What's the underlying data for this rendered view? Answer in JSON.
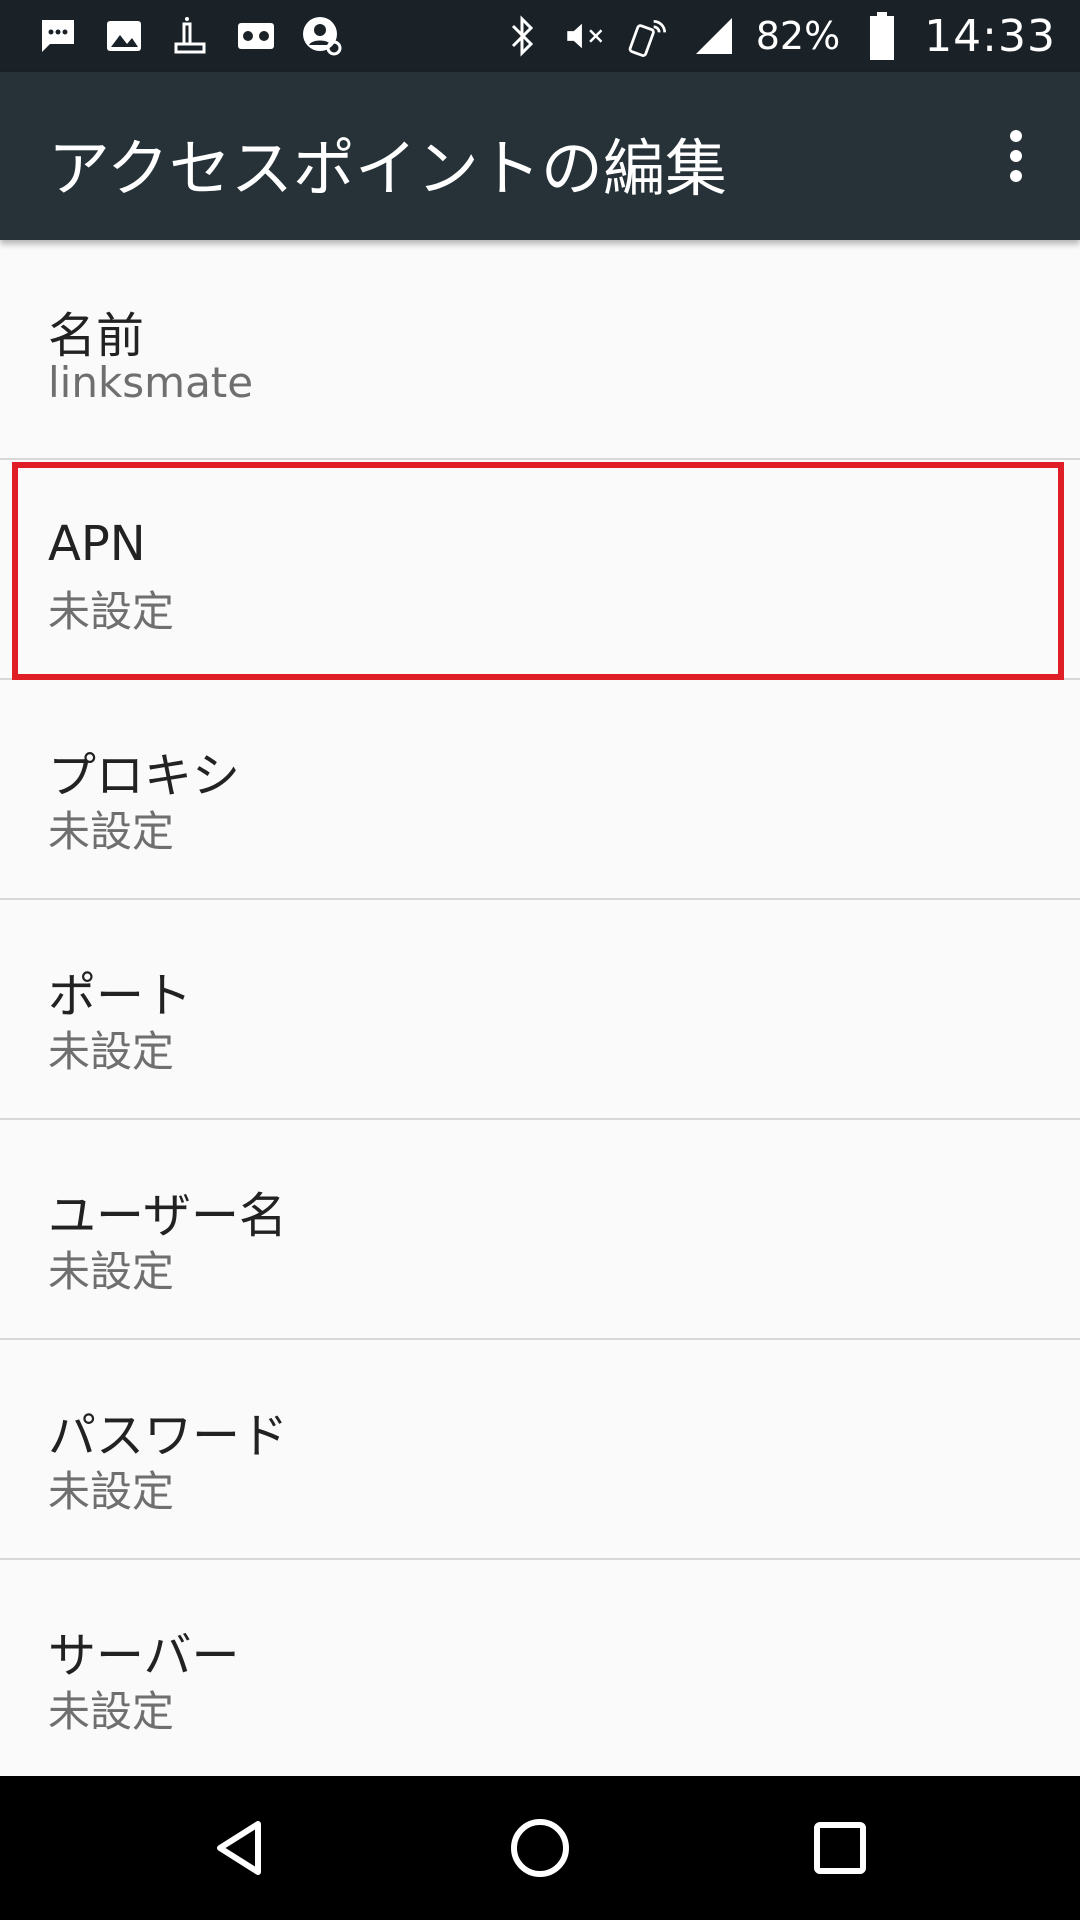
{
  "status_bar": {
    "left_icons": [
      "sms-icon",
      "gallery-icon",
      "app-icon",
      "voicemail-icon",
      "account-icon"
    ],
    "battery_percent_label": "82%",
    "battery_level": 0.82,
    "time": "14:33",
    "right_icons": [
      "bluetooth-icon",
      "mute-icon",
      "nfc-icon",
      "signal-icon",
      "battery-icon"
    ]
  },
  "app_bar": {
    "title": "アクセスポイントの編集",
    "menu_icon": "more-vert-icon"
  },
  "settings": [
    {
      "title": "名前",
      "summary": "linksmate"
    },
    {
      "title": "APN",
      "summary": "未設定"
    },
    {
      "title": "プロキシ",
      "summary": "未設定"
    },
    {
      "title": "ポート",
      "summary": "未設定"
    },
    {
      "title": "ユーザー名",
      "summary": "未設定"
    },
    {
      "title": "パスワード",
      "summary": "未設定"
    },
    {
      "title": "サーバー",
      "summary": "未設定"
    }
  ],
  "highlight": {
    "target": "APN",
    "color": "#e01e25"
  },
  "nav_bar": {
    "icons": [
      "back-icon",
      "home-icon",
      "recents-icon"
    ]
  },
  "colors": {
    "status_bar": "#1b2227",
    "app_bar": "#263238",
    "background": "#fafafa"
  }
}
